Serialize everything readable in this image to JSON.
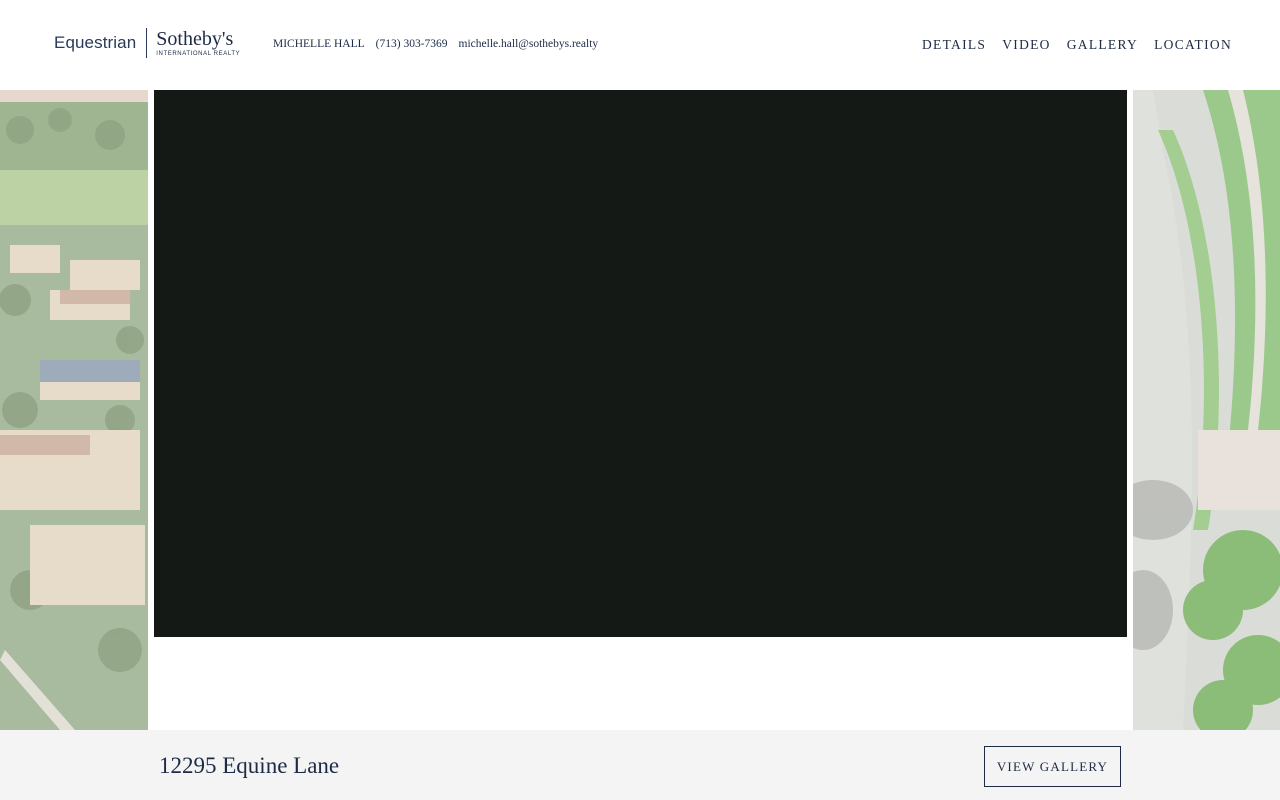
{
  "brand": {
    "left": "Equestrian",
    "name": "Sotheby's",
    "sub": "INTERNATIONAL REALTY"
  },
  "contact": {
    "name": "MICHELLE HALL",
    "phone": "(713) 303-7369",
    "email": "michelle.hall@sothebys.realty"
  },
  "nav": [
    "DETAILS",
    "VIDEO",
    "GALLERY",
    "LOCATION"
  ],
  "property": {
    "address": "12295 Equine Lane"
  },
  "buttons": {
    "view_gallery": "VIEW GALLERY"
  },
  "colors": {
    "navy": "#1d2b45",
    "video_bg": "#151916",
    "footer_bg": "#f4f4f4"
  }
}
